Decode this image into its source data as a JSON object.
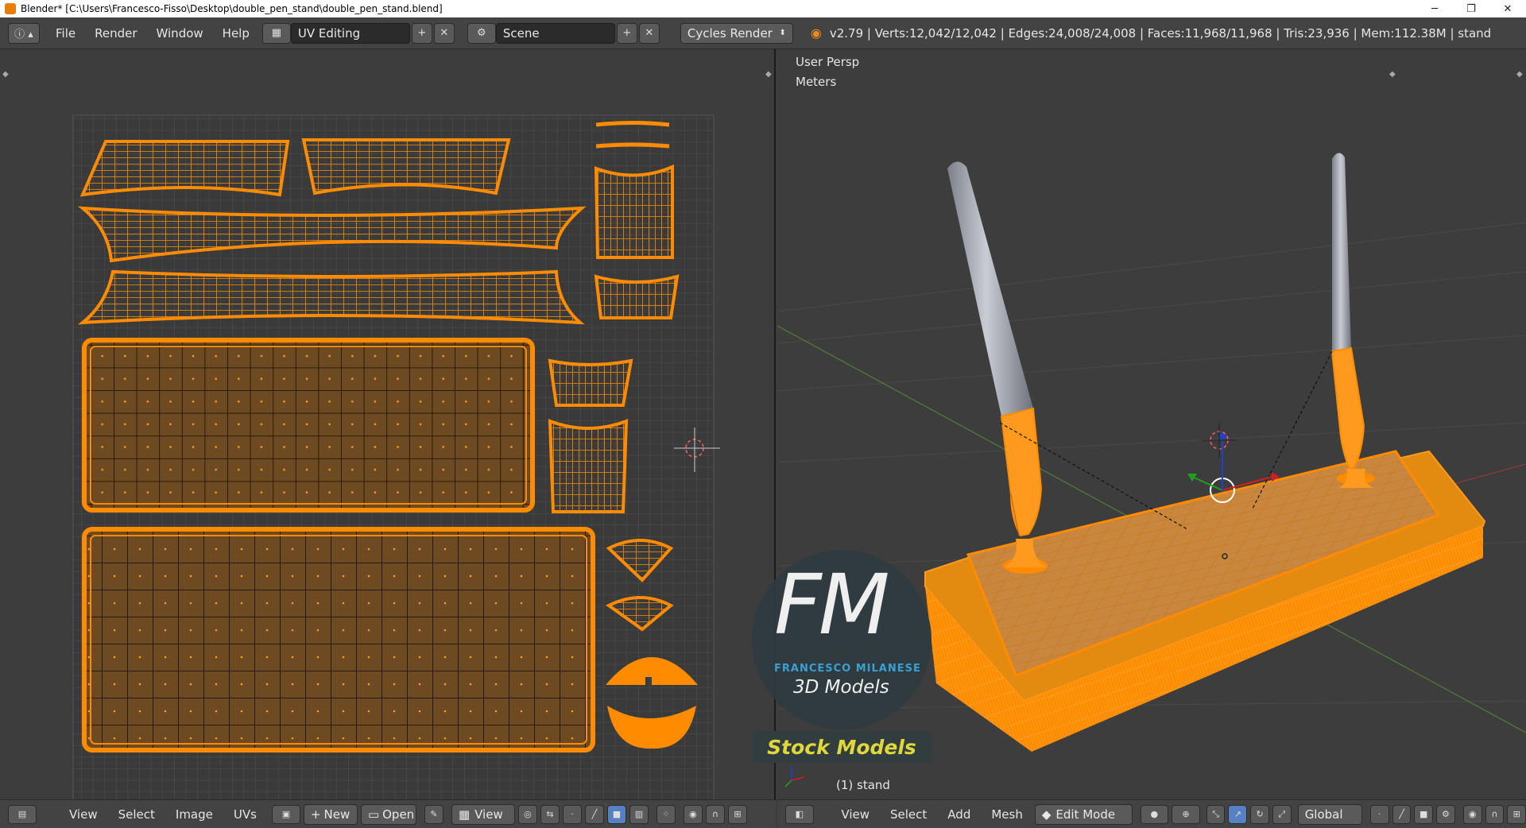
{
  "window": {
    "title": "Blender* [C:\\Users\\Francesco-Fisso\\Desktop\\double_pen_stand\\double_pen_stand.blend]",
    "minimize": "─",
    "maximize": "❐",
    "close": "✕"
  },
  "info_header": {
    "menus": [
      "File",
      "Render",
      "Window",
      "Help"
    ],
    "layout": "UV Editing",
    "scene": "Scene",
    "engine": "Cycles Render",
    "stats": "v2.79 | Verts:12,042/12,042 | Edges:24,008/24,008 | Faces:11,968/11,968 | Tris:23,936 | Mem:112.38M | stand"
  },
  "uv_editor": {
    "menus": [
      "View",
      "Select",
      "Image",
      "UVs"
    ],
    "new_label": "New",
    "open_label": "Open",
    "view_label": "View"
  },
  "viewport": {
    "persp_label": "User Persp",
    "units_label": "Meters",
    "object_label": "(1) stand",
    "menus": [
      "View",
      "Select",
      "Add",
      "Mesh"
    ],
    "mode": "Edit Mode",
    "orientation": "Global"
  },
  "watermark": {
    "logo": "FM",
    "name": "FRANCESCO MILANESE",
    "subtitle": "3D Models",
    "stock": "Stock Models"
  },
  "colors": {
    "uv_orange": "#ff8c00",
    "panel_bg": "#3d3d3d",
    "header_bg": "#434343",
    "accent_blue": "#5680c2"
  },
  "icons": {
    "info": "info-icon",
    "blender": "blender-logo-icon",
    "axis": "axis-gizmo-icon"
  }
}
